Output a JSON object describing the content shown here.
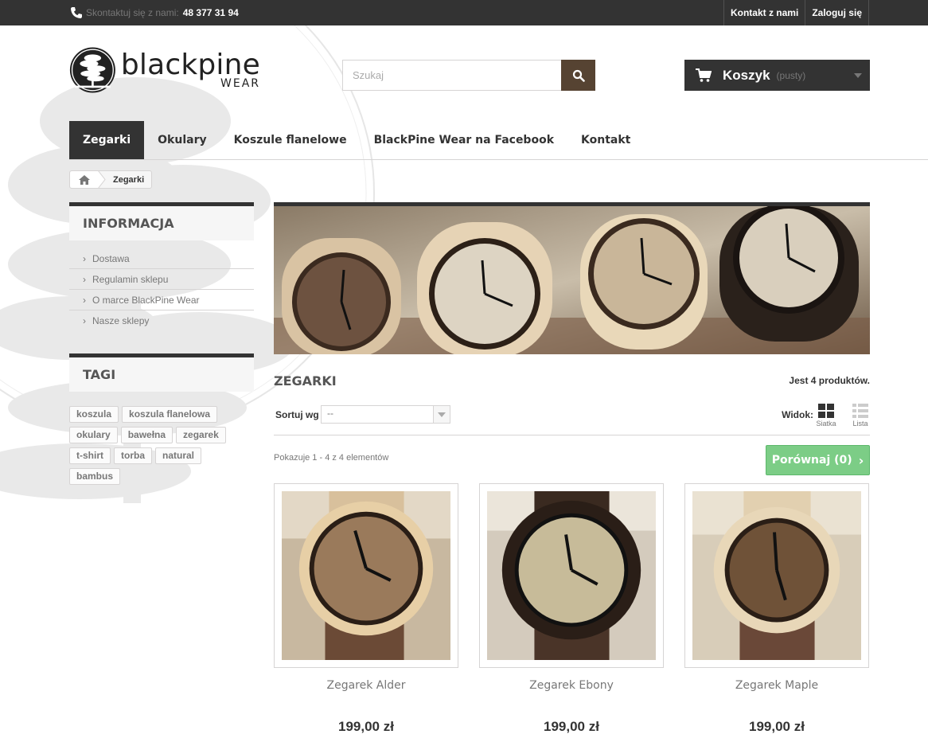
{
  "topbar": {
    "contact_label": "Skontaktuj się z nami:",
    "phone": "48 377 31 94",
    "links": [
      "Kontakt z nami",
      "Zaloguj się"
    ]
  },
  "logo": {
    "main": "blackpine",
    "sub": "WEAR"
  },
  "search": {
    "placeholder": "Szukaj",
    "value": ""
  },
  "cart": {
    "label": "Koszyk",
    "status": "(pusty)"
  },
  "menu": [
    "Zegarki",
    "Okulary",
    "Koszule flanelowe",
    "BlackPine Wear na Facebook",
    "Kontakt"
  ],
  "breadcrumb": {
    "current": "Zegarki"
  },
  "sidebar": {
    "info_title": "INFORMACJA",
    "info_items": [
      "Dostawa",
      "Regulamin sklepu",
      "O marce BlackPine Wear",
      "Nasze sklepy"
    ],
    "tags_title": "TAGI",
    "tags": [
      "koszula",
      "koszula flanelowa",
      "okulary",
      "bawełna",
      "zegarek",
      "t-shirt",
      "torba",
      "natural",
      "bambus"
    ]
  },
  "category": {
    "name": "ZEGARKI",
    "count": "Jest 4 produktów.",
    "sort_label": "Sortuj wg",
    "sort_value": "--",
    "view_label": "Widok:",
    "view_grid": "Siatka",
    "view_list": "Lista",
    "showing": "Pokazuje 1 - 4 z 4 elementów",
    "compare": "Porównaj (0)"
  },
  "products": [
    {
      "name": "Zegarek Alder",
      "price": "199,00 zł"
    },
    {
      "name": "Zegarek Ebony",
      "price": "199,00 zł"
    },
    {
      "name": "Zegarek Maple",
      "price": "199,00 zł"
    }
  ],
  "colors": {
    "dark": "#333333",
    "search_button": "#564332",
    "compare": "#7ccd86"
  }
}
